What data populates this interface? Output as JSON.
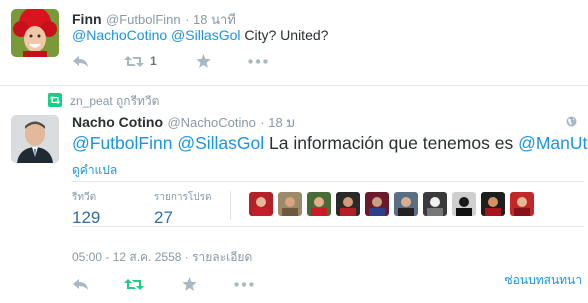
{
  "tweet1": {
    "name": "Finn",
    "screen_name": "@FutbolFinn",
    "time": "18 นาที",
    "text_mention1": "@NachoCotino",
    "text_mention2": "@SillasGol",
    "text_rest": " City? United?",
    "retweet_count": "1",
    "icons": [
      "reply-icon",
      "retweet-icon",
      "favorite-icon",
      "more-icon"
    ]
  },
  "retweet_context": {
    "text": "zn_peat ถูกรีทวีต",
    "icon": "retweet-icon"
  },
  "tweet2": {
    "name": "Nacho Cotino",
    "screen_name": "@NachoCotino",
    "time": "18 ນ",
    "text_mention1": "@FutbolFinn",
    "text_mention2": "@SillasGol",
    "text_middle": " La información que tenemos es ",
    "text_mention3": "@ManUtd",
    "translate_link": "ดูคำแปล",
    "stats": {
      "retweets_label": "รีทวีต",
      "retweets": "129",
      "favorites_label": "รายการโปรด",
      "favorites": "27"
    },
    "meta": "05:00 - 12 ส.ค. 2558 · รายละเอียด",
    "collapse_link": "ซ่อนบทสนทนา",
    "icons": [
      "reply-icon",
      "retweet-icon",
      "favorite-icon",
      "more-icon",
      "globe-icon"
    ]
  },
  "colors": {
    "link": "#1b95e0",
    "muted": "#8899a6",
    "retweeted": "#19cf86",
    "stat_value": "#2f6fa3"
  }
}
